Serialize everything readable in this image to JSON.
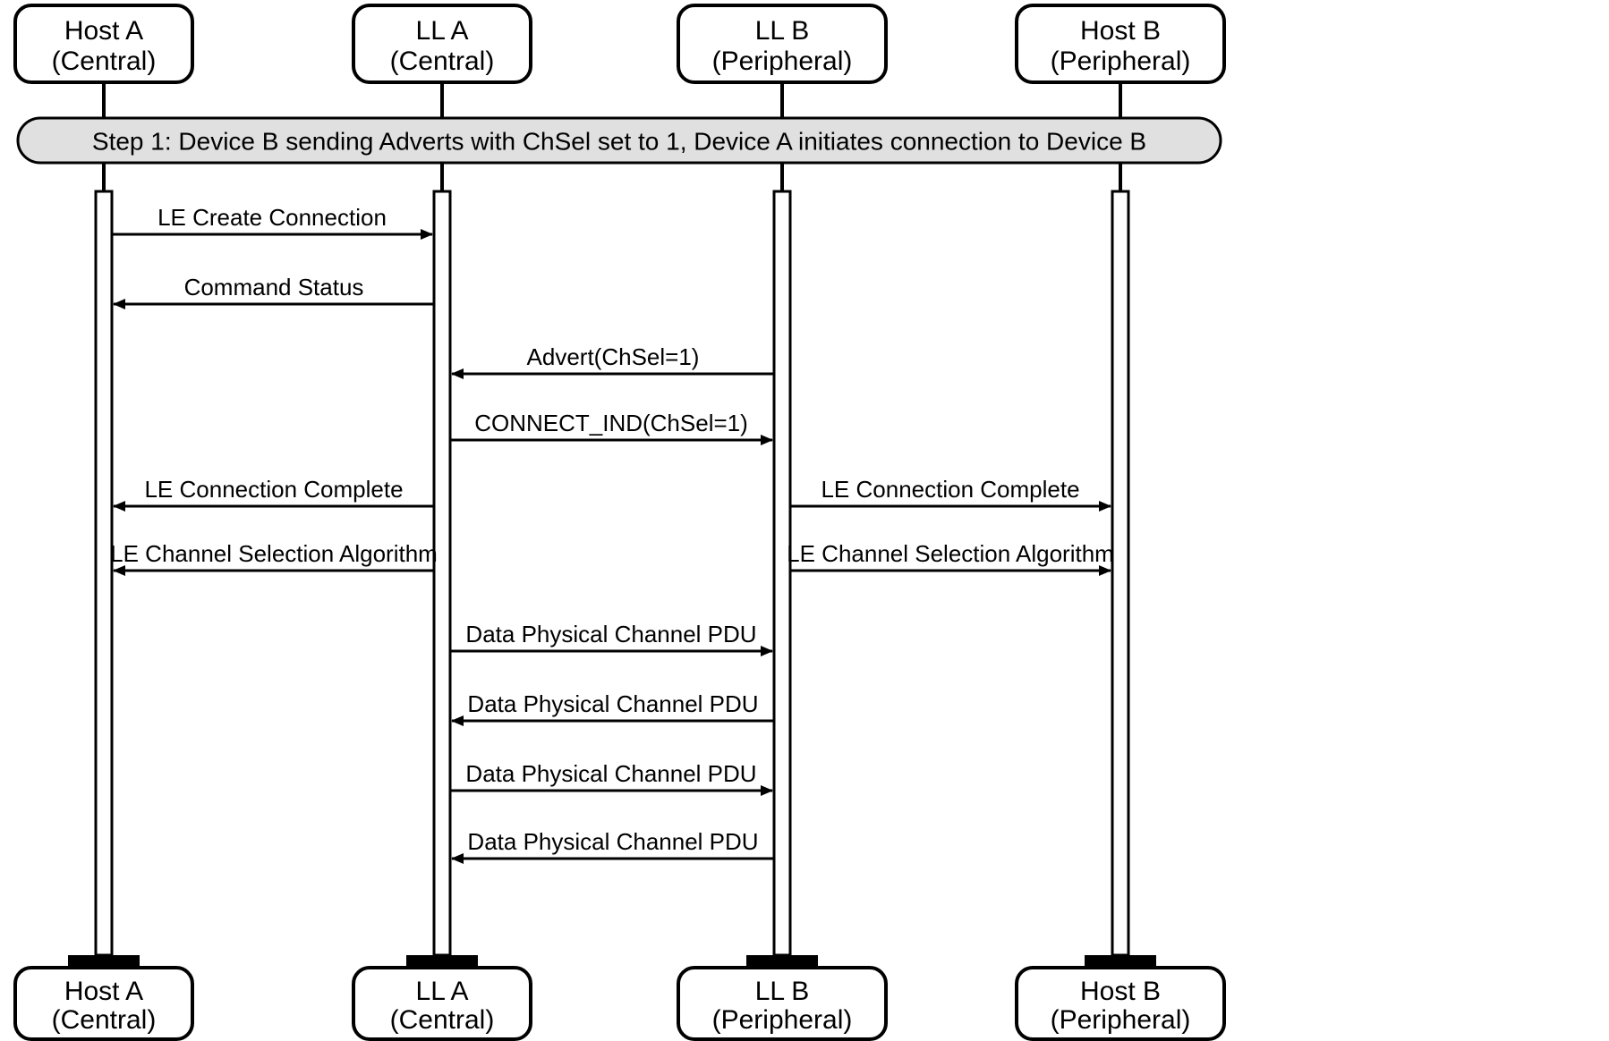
{
  "actors": {
    "hostA": {
      "line1": "Host A",
      "line2": "(Central)"
    },
    "llA": {
      "line1": "LL A",
      "line2": "(Central)"
    },
    "llB": {
      "line1": "LL B",
      "line2": "(Peripheral)"
    },
    "hostB": {
      "line1": "Host B",
      "line2": "(Peripheral)"
    }
  },
  "step": {
    "label": "Step 1:  Device B sending Adverts with ChSel set to 1, Device A initiates connection to Device B"
  },
  "messages": {
    "m1": "LE Create Connection",
    "m2": "Command Status",
    "m3": "Advert(ChSel=1)",
    "m4": "CONNECT_IND(ChSel=1)",
    "m5a": "LE Connection Complete",
    "m5b": "LE Connection Complete",
    "m6a": "LE Channel Selection Algorithm",
    "m6b": "LE Channel Selection Algorithm",
    "m7": "Data Physical Channel PDU",
    "m8": "Data Physical Channel PDU",
    "m9": "Data Physical Channel PDU",
    "m10": "Data Physical Channel PDU"
  },
  "footerActors": {
    "hostA": {
      "line1": "Host A",
      "line2": "(Central)"
    },
    "llA": {
      "line1": "LL A",
      "line2": "(Central)"
    },
    "llB": {
      "line1": "LL B",
      "line2": "(Peripheral)"
    },
    "hostB": {
      "line1": "Host B",
      "line2": "(Peripheral)"
    }
  }
}
